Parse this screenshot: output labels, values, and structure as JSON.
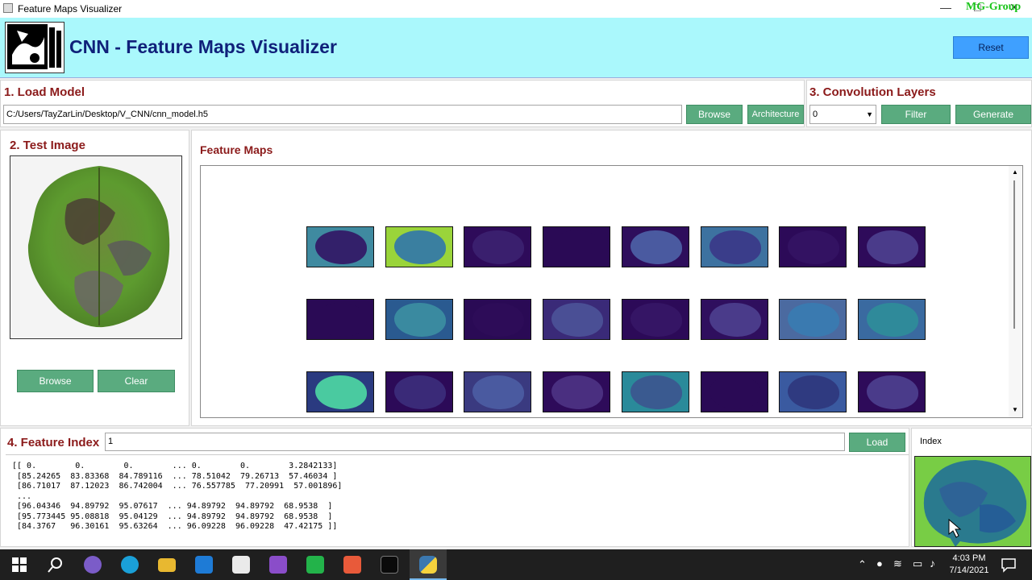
{
  "window": {
    "title": "Feature Maps Visualizer",
    "watermark": "MG-Group",
    "minimize": "—",
    "maximize": "□",
    "close": "✕"
  },
  "header": {
    "app_title": "CNN - Feature Maps Visualizer",
    "reset_label": "Reset"
  },
  "load_model": {
    "title": "1. Load Model",
    "path": "C:/Users/TayZarLin/Desktop/V_CNN/cnn_model.h5",
    "browse_label": "Browse",
    "architecture_label": "Architecture"
  },
  "conv_layers": {
    "title": "3. Convolution Layers",
    "selected": "0",
    "filter_label": "Filter",
    "generate_label": "Generate"
  },
  "test_image": {
    "title": "2. Test Image",
    "browse_label": "Browse",
    "clear_label": "Clear"
  },
  "feature_maps": {
    "title": "Feature Maps",
    "rows": 3,
    "cols": 8
  },
  "feature_index": {
    "title": "4. Feature Index",
    "value": "1",
    "load_label": "Load",
    "index_label": "Index",
    "matrix_lines": [
      "[[ 0.        0.        0.        ... 0.        0.        3.2842133]",
      " [85.24265  83.83368  84.789116  ... 78.51042  79.26713  57.46034 ]",
      " [86.71017  87.12023  86.742004  ... 76.557785  77.20991  57.001896]",
      " ...",
      " [96.04346  94.89792  95.07617  ... 94.89792  94.89792  68.9538  ]",
      " [95.773445 95.08818  95.04129  ... 94.89792  94.89792  68.9538  ]",
      " [84.3767   96.30161  95.63264  ... 96.09228  96.09228  47.42175 ]]"
    ]
  },
  "taskbar": {
    "time": "4:03 PM",
    "date": "7/14/2021"
  },
  "colors": {
    "header_bg": "#aaf8fc",
    "title_color": "#10217a",
    "section_title": "#8b1a1a",
    "button_green": "#5aab7f",
    "reset_blue": "#3fa0ff"
  }
}
